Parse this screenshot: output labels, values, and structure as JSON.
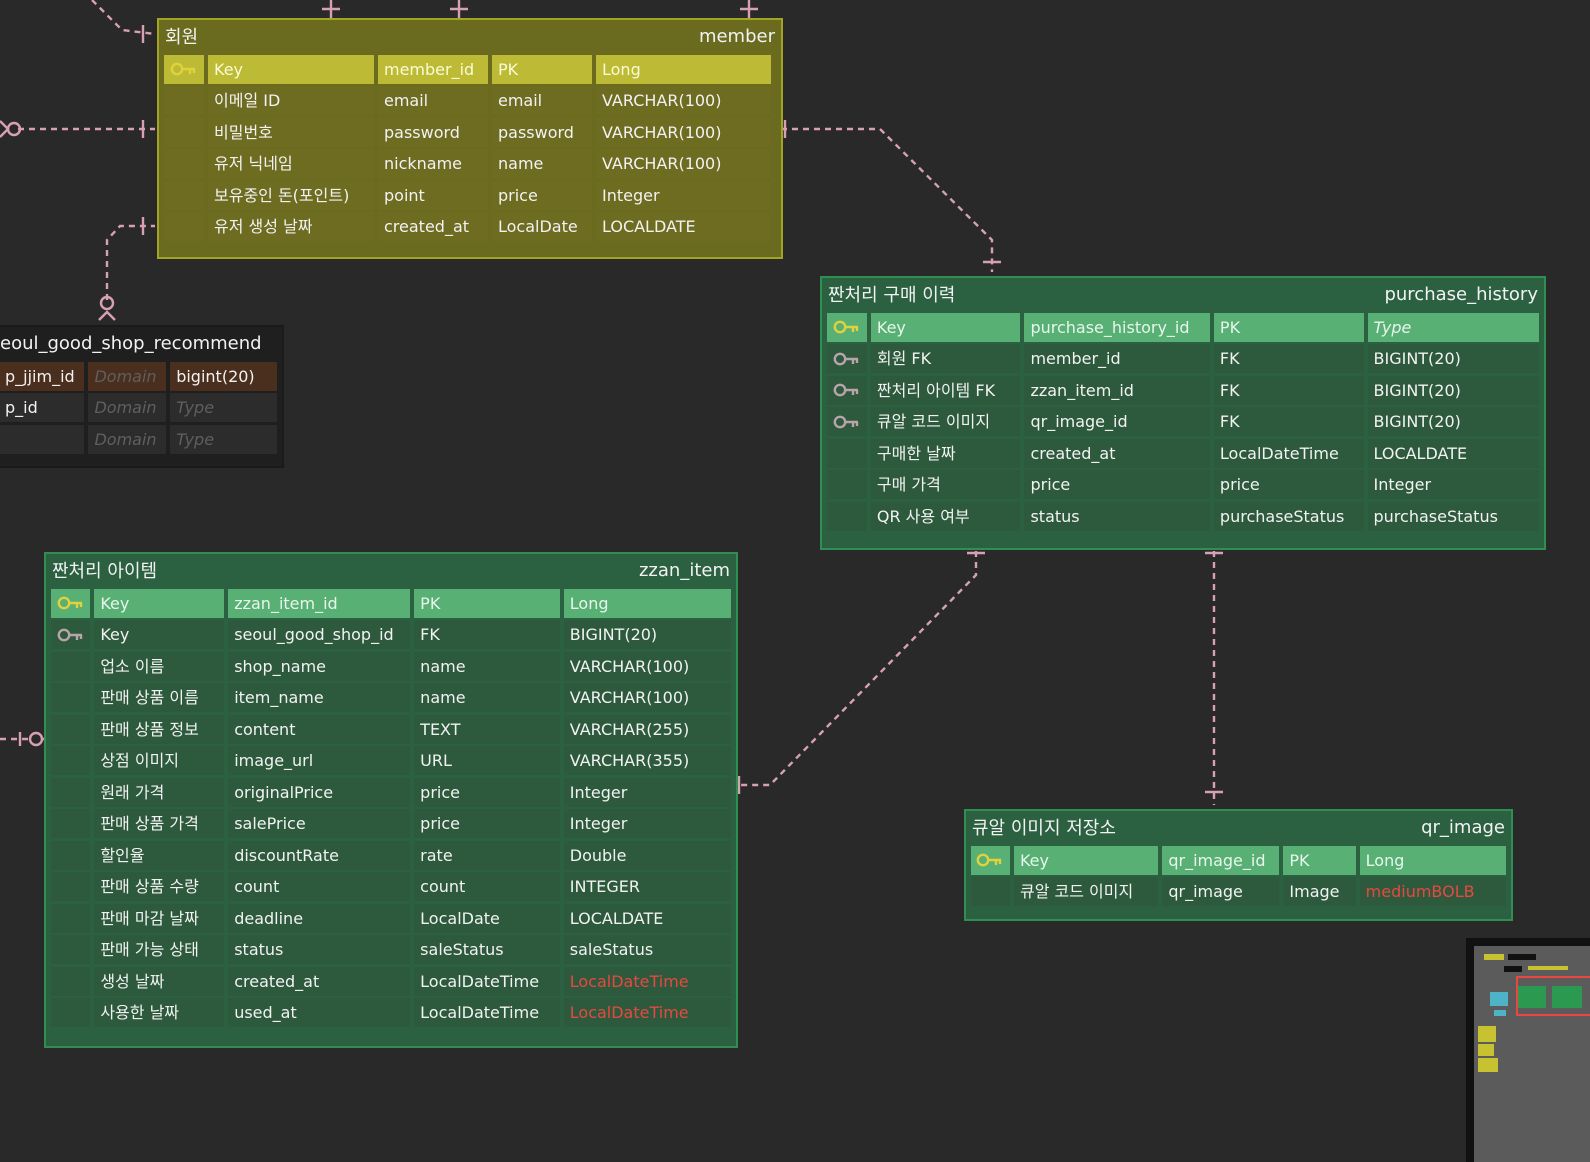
{
  "colors": {
    "background": "#292929",
    "member_header": "#6b6b20",
    "member_key": "#bdbb35",
    "green_header": "#2b6041",
    "green_key": "#58b075",
    "link": "#d8a0b4",
    "highlight_red": "#e8483f",
    "key_icon_yellow": "#e0d23c",
    "key_icon_gray": "#b9a4ad"
  },
  "tables": {
    "member": {
      "logical_name": "회원",
      "physical_name": "member",
      "key_row": [
        "Key",
        "member_id",
        "PK",
        "Long"
      ],
      "rows": [
        [
          "이메일 ID",
          "email",
          "email",
          "VARCHAR(100)"
        ],
        [
          "비밀번호",
          "password",
          "password",
          "VARCHAR(100)"
        ],
        [
          "유저 닉네임",
          "nickname",
          "name",
          "VARCHAR(100)"
        ],
        [
          "보유중인 돈(포인트)",
          "point",
          "price",
          "Integer"
        ],
        [
          "유저 생성 날짜",
          "created_at",
          "LocalDate",
          "LOCALDATE"
        ]
      ]
    },
    "purchase_history": {
      "logical_name": "짠처리 구매 이력",
      "physical_name": "purchase_history",
      "key_row": [
        "Key",
        "purchase_history_id",
        "PK",
        "Type"
      ],
      "rows": [
        [
          "회원 FK",
          "member_id",
          "FK",
          "BIGINT(20)"
        ],
        [
          "짠처리 아이템 FK",
          "zzan_item_id",
          "FK",
          "BIGINT(20)"
        ],
        [
          "큐알 코드 이미지",
          "qr_image_id",
          "FK",
          "BIGINT(20)"
        ],
        [
          "구매한 날짜",
          "created_at",
          "LocalDateTime",
          "LOCALDATE"
        ],
        [
          "구매 가격",
          "price",
          "price",
          "Integer"
        ],
        [
          "QR 사용 여부",
          "status",
          "purchaseStatus",
          "purchaseStatus"
        ]
      ]
    },
    "seoul_good_shop_recommend": {
      "physical_name": "eoul_good_shop_recommend",
      "rows": [
        [
          "p_jjim_id",
          "Domain",
          "bigint(20)"
        ],
        [
          "p_id",
          "Domain",
          "Type"
        ],
        [
          "",
          "Domain",
          "Type"
        ]
      ]
    },
    "zzan_item": {
      "logical_name": "짠처리 아이템",
      "physical_name": "zzan_item",
      "key_row": [
        "Key",
        "zzan_item_id",
        "PK",
        "Long"
      ],
      "rows": [
        [
          "Key",
          "seoul_good_shop_id",
          "FK",
          "BIGINT(20)"
        ],
        [
          "업소 이름",
          "shop_name",
          "name",
          "VARCHAR(100)"
        ],
        [
          "판매 상품 이름",
          "item_name",
          "name",
          "VARCHAR(100)"
        ],
        [
          "판매 상품 정보",
          "content",
          "TEXT",
          "VARCHAR(255)"
        ],
        [
          "상점 이미지",
          "image_url",
          "URL",
          "VARCHAR(355)"
        ],
        [
          "원래 가격",
          "originalPrice",
          "price",
          "Integer"
        ],
        [
          "판매 상품 가격",
          "salePrice",
          "price",
          "Integer"
        ],
        [
          "할인율",
          "discountRate",
          "rate",
          "Double"
        ],
        [
          "판매 상품 수량",
          "count",
          "count",
          "INTEGER"
        ],
        [
          "판매 마감 날짜",
          "deadline",
          "LocalDate",
          "LOCALDATE"
        ],
        [
          "판매 가능 상태",
          "status",
          "saleStatus",
          "saleStatus"
        ],
        [
          "생성 날짜",
          "created_at",
          "LocalDateTime",
          "LocalDateTime"
        ],
        [
          "사용한 날짜",
          "used_at",
          "LocalDateTime",
          "LocalDateTime"
        ]
      ]
    },
    "qr_image": {
      "logical_name": "큐알 이미지 저장소",
      "physical_name": "qr_image",
      "key_row": [
        "Key",
        "qr_image_id",
        "PK",
        "Long"
      ],
      "rows": [
        [
          "큐알 코드 이미지",
          "qr_image",
          "Image",
          "mediumBOLB"
        ]
      ]
    }
  }
}
